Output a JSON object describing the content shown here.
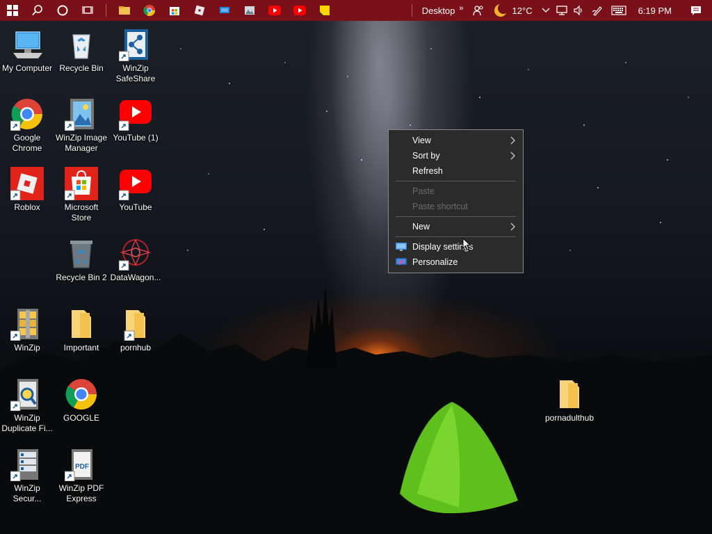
{
  "taskbar": {
    "desktop_label": "Desktop",
    "temperature": "12°C",
    "time": "6:19 PM"
  },
  "desktop_icons": [
    {
      "label": "My Computer"
    },
    {
      "label": "Recycle Bin"
    },
    {
      "label": "WinZip SafeShare"
    },
    {
      "label": "Google Chrome"
    },
    {
      "label": "WinZip Image Manager"
    },
    {
      "label": "YouTube (1)"
    },
    {
      "label": "Roblox"
    },
    {
      "label": "Microsoft Store"
    },
    {
      "label": "YouTube"
    },
    {
      "label": "Recycle Bin 2"
    },
    {
      "label": "DataWagon..."
    },
    {
      "label": "WinZip"
    },
    {
      "label": "Important"
    },
    {
      "label": "pornhub"
    },
    {
      "label": "WinZip Duplicate Fi..."
    },
    {
      "label": "GOOGLE"
    },
    {
      "label": "WinZip Secur..."
    },
    {
      "label": "WinZip PDF Express"
    },
    {
      "label": "pornadulthub"
    }
  ],
  "context_menu": {
    "view": "View",
    "sort_by": "Sort by",
    "refresh": "Refresh",
    "paste": "Paste",
    "paste_shortcut": "Paste shortcut",
    "new": "New",
    "display_settings": "Display settings",
    "personalize": "Personalize"
  },
  "colors": {
    "taskbar": "#7a1018",
    "menu_bg": "#2b2b2b",
    "menu_text": "#ffffff",
    "menu_disabled": "#6d6d6d"
  }
}
